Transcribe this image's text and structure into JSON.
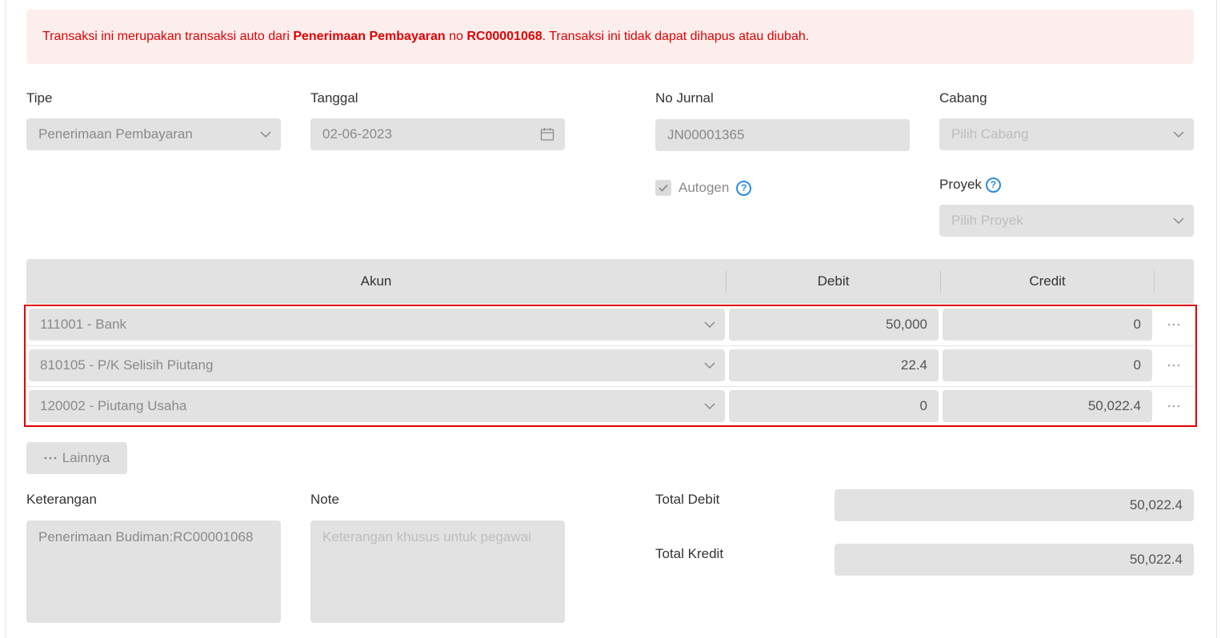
{
  "alert": {
    "text_before": "Transaksi ini merupakan transaksi auto dari ",
    "source_type": "Penerimaan Pembayaran",
    "text_middle": " no ",
    "source_number": "RC00001068",
    "text_after": ". Transaksi ini tidak dapat dihapus atau diubah."
  },
  "form": {
    "tipe": {
      "label": "Tipe",
      "value": "Penerimaan Pembayaran"
    },
    "tanggal": {
      "label": "Tanggal",
      "value": "02-06-2023"
    },
    "no_jurnal": {
      "label": "No Jurnal",
      "value": "JN00001365"
    },
    "cabang": {
      "label": "Cabang",
      "placeholder": "Pilih Cabang"
    },
    "autogen": {
      "label": "Autogen",
      "checked": true
    },
    "proyek": {
      "label": "Proyek",
      "placeholder": "Pilih Proyek"
    },
    "help_glyph": "?"
  },
  "table": {
    "headers": {
      "akun": "Akun",
      "debit": "Debit",
      "credit": "Credit"
    },
    "rows": [
      {
        "akun": "111001 - Bank",
        "debit": "50,000",
        "credit": "0"
      },
      {
        "akun": "810105 - P/K Selisih Piutang",
        "debit": "22.4",
        "credit": "0"
      },
      {
        "akun": "120002 - Piutang Usaha",
        "debit": "0",
        "credit": "50,022.4"
      }
    ]
  },
  "more_button": {
    "label": "Lainnya"
  },
  "keterangan": {
    "label": "Keterangan",
    "value": "Penerimaan Budiman:RC00001068"
  },
  "note": {
    "label": "Note",
    "placeholder": "Keterangan khusus untuk pegawai"
  },
  "totals": {
    "debit_label": "Total Debit",
    "debit_value": "50,022.4",
    "kredit_label": "Total Kredit",
    "kredit_value": "50,022.4"
  },
  "colors": {
    "alert_bg": "#fdeeee",
    "alert_text": "#e10000",
    "field_bg": "#e2e2e2",
    "help_icon": "#2a8cde",
    "highlight_border": "#e00000"
  },
  "icons": [
    "chevron-down-icon",
    "calendar-icon",
    "help-icon",
    "check-icon",
    "ellipsis-icon"
  ]
}
